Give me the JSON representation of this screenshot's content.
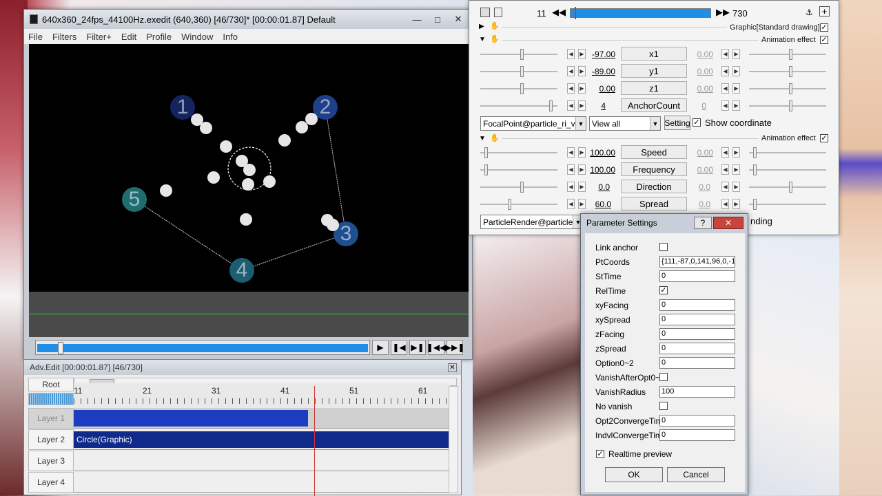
{
  "main_window": {
    "title": "640x360_24fps_44100Hz.exedit (640,360)  [46/730]* [00:00:01.87]  Default",
    "menu": [
      "File",
      "Filters",
      "Filter+",
      "Edit",
      "Profile",
      "Window",
      "Info"
    ],
    "anchors": [
      "1",
      "2",
      "3",
      "4",
      "5"
    ],
    "playback_buttons": [
      "play-icon",
      "step-back-icon",
      "step-forward-icon",
      "skip-start-icon",
      "skip-end-icon"
    ]
  },
  "timeline": {
    "title": "Adv.Edit [00:00:01.87] [46/730]",
    "root_label": "Root",
    "ruler_labels": [
      "11",
      "21",
      "31",
      "41",
      "51",
      "61"
    ],
    "layers": [
      "Layer 1",
      "Layer 2",
      "Layer 3",
      "Layer 4"
    ],
    "clip_layer2_label": "Circle(Graphic)"
  },
  "settings": {
    "frame_current": "11",
    "frame_total": "730",
    "progress_fraction": 0.02,
    "graphic_label": "Graphic[Standard drawing]",
    "anim_effect_label": "Animation effect",
    "rows1": [
      {
        "value": "-97.00",
        "name": "x1",
        "end": "0.00"
      },
      {
        "value": "-89.00",
        "name": "y1",
        "end": "0.00"
      },
      {
        "value": "0.00",
        "name": "z1",
        "end": "0.00"
      },
      {
        "value": "4",
        "name": "AnchorCount",
        "end": "0"
      }
    ],
    "focal_dropdown": "FocalPoint@particle_ri_v",
    "view_dropdown": "View all",
    "setting_button": "Setting",
    "show_coordinate": "Show coordinate",
    "rows2": [
      {
        "value": "100.00",
        "name": "Speed",
        "end": "0.00"
      },
      {
        "value": "100.00",
        "name": "Frequency",
        "end": "0.00"
      },
      {
        "value": "0.0",
        "name": "Direction",
        "end": "0.0"
      },
      {
        "value": "60.0",
        "name": "Spread",
        "end": "0.0"
      }
    ],
    "render_dropdown": "ParticleRender@particle",
    "render_tail": "nding"
  },
  "param_dialog": {
    "title": "Parameter Settings",
    "rows": [
      {
        "label": "Link anchor",
        "type": "check",
        "checked": false
      },
      {
        "label": "PtCoords",
        "type": "text",
        "value": "{111,-87,0,141,96,0,-1"
      },
      {
        "label": "StTime",
        "type": "text",
        "value": "0"
      },
      {
        "label": "RelTime",
        "type": "check",
        "checked": true
      },
      {
        "label": "xyFacing",
        "type": "text",
        "value": "0"
      },
      {
        "label": "xySpread",
        "type": "text",
        "value": "0"
      },
      {
        "label": "zFacing",
        "type": "text",
        "value": "0"
      },
      {
        "label": "zSpread",
        "type": "text",
        "value": "0"
      },
      {
        "label": "Option0~2",
        "type": "text",
        "value": "0"
      },
      {
        "label": "VanishAfterOpt0~",
        "type": "check",
        "checked": false
      },
      {
        "label": "VanishRadius",
        "type": "text",
        "value": "100"
      },
      {
        "label": "No vanish",
        "type": "check",
        "checked": false
      },
      {
        "label": "Opt2ConvergeTim",
        "type": "text",
        "value": "0"
      },
      {
        "label": "IndvlConvergeTim",
        "type": "text",
        "value": "0"
      }
    ],
    "realtime_preview": "Realtime preview",
    "ok_label": "OK",
    "cancel_label": "Cancel"
  },
  "colors": {
    "seek_fill": "#1e8ee8",
    "clip_dark": "#0f2a8a",
    "clip_bright": "#1c3dbf",
    "cursor": "#d23232"
  }
}
